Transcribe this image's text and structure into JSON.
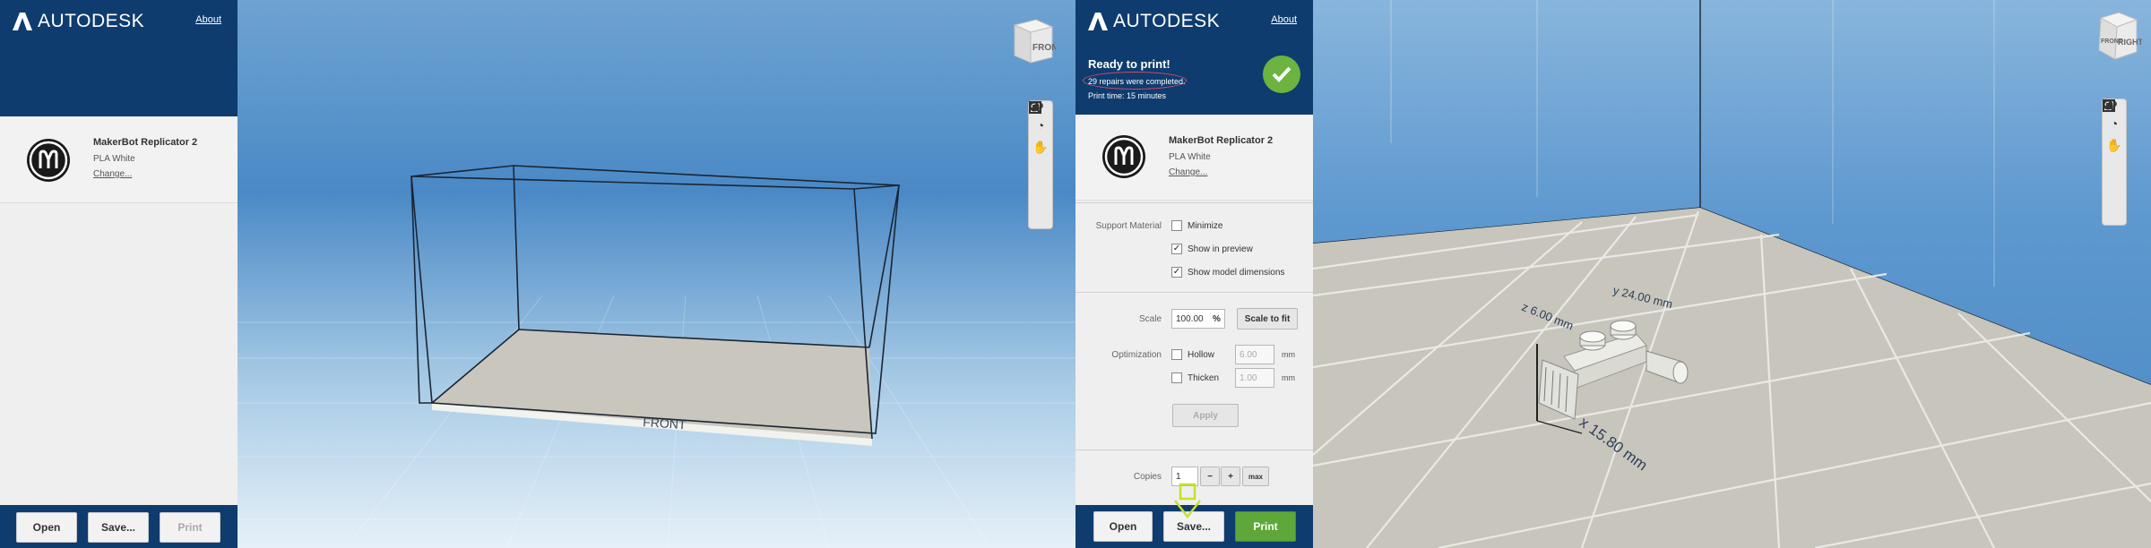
{
  "brand": "AUTODESK",
  "left_panel": {
    "about": "About",
    "printer": {
      "name": "MakerBot Replicator 2",
      "material": "PLA White",
      "change": "Change..."
    },
    "buttons": {
      "open": "Open",
      "save": "Save...",
      "print": "Print"
    }
  },
  "left_view": {
    "floor_label": "FRONT",
    "cube_face": "FRONT"
  },
  "right_panel": {
    "about": "About",
    "status": {
      "title": "Ready to print!",
      "repairs": "29 repairs were completed.",
      "print_time": "Print time: 15 minutes"
    },
    "printer": {
      "name": "MakerBot Replicator 2",
      "material": "PLA White",
      "change": "Change..."
    },
    "support": {
      "label": "Support Material",
      "minimize": {
        "label": "Minimize",
        "checked": false
      },
      "show_preview": {
        "label": "Show in preview",
        "checked": true
      },
      "show_dimensions": {
        "label": "Show model dimensions",
        "checked": true
      }
    },
    "scale": {
      "label": "Scale",
      "value": "100.00",
      "unit": "%",
      "fit_button": "Scale to fit"
    },
    "optimization": {
      "label": "Optimization",
      "hollow": {
        "label": "Hollow",
        "value": "6.00",
        "unit": "mm",
        "checked": false
      },
      "thicken": {
        "label": "Thicken",
        "value": "1.00",
        "unit": "mm",
        "checked": false
      },
      "apply": "Apply"
    },
    "copies": {
      "label": "Copies",
      "value": "1",
      "minus": "−",
      "plus": "+",
      "max": "max"
    },
    "buttons": {
      "open": "Open",
      "save": "Save...",
      "print": "Print"
    }
  },
  "right_view": {
    "cube_face_front": "FRONT",
    "cube_face_right": "RIGHT",
    "dimensions": {
      "x": "x 15.80 mm",
      "y": "y 24.00 mm",
      "z": "z 6.00 mm"
    }
  },
  "toolbar_icons": [
    "orbit-icon",
    "pan-icon",
    "zoom-icon",
    "fit-icon",
    "visibility-icon"
  ],
  "colors": {
    "header": "#0f3c6e",
    "accent_green": "#5ea73a",
    "check_green": "#6cb33f",
    "highlight_yellow": "#c8e02a"
  }
}
